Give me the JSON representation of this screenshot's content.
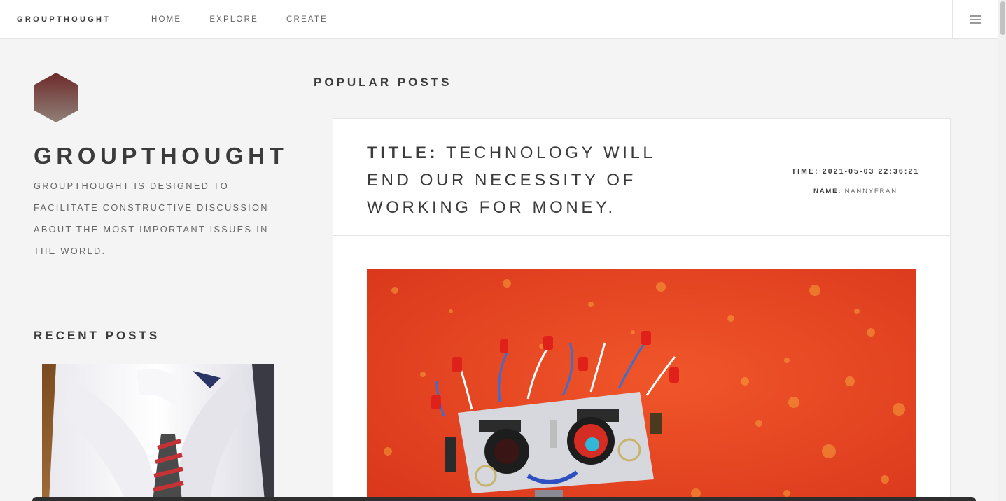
{
  "header": {
    "brand": "GROUPTHOUGHT",
    "nav": [
      {
        "label": "HOME"
      },
      {
        "label": "EXPLORE"
      },
      {
        "label": "CREATE"
      }
    ],
    "menu_icon": "hamburger-icon"
  },
  "sidebar": {
    "logo_icon": "hexagon-logo",
    "title": "GROUPTHOUGHT",
    "description": "GROUPTHOUGHT IS DESIGNED TO FACILITATE CONSTRUCTIVE DISCUSSION ABOUT THE MOST IMPORTANT ISSUES IN THE WORLD.",
    "recent_heading": "RECENT POSTS"
  },
  "main": {
    "popular_heading": "POPULAR POSTS",
    "post": {
      "title_label": "TITLE:",
      "title": "TECHNOLOGY WILL END OUR NECESSITY OF WORKING FOR MONEY.",
      "time_label": "TIME:",
      "time": "2021-05-03 22:36:21",
      "name_label": "NAME:",
      "name": "NANNYFRAN"
    }
  },
  "colors": {
    "text": "#3c3b3b",
    "muted": "#646464",
    "background": "#f4f4f4",
    "card": "#ffffff",
    "image_orange": "#e8421e"
  }
}
